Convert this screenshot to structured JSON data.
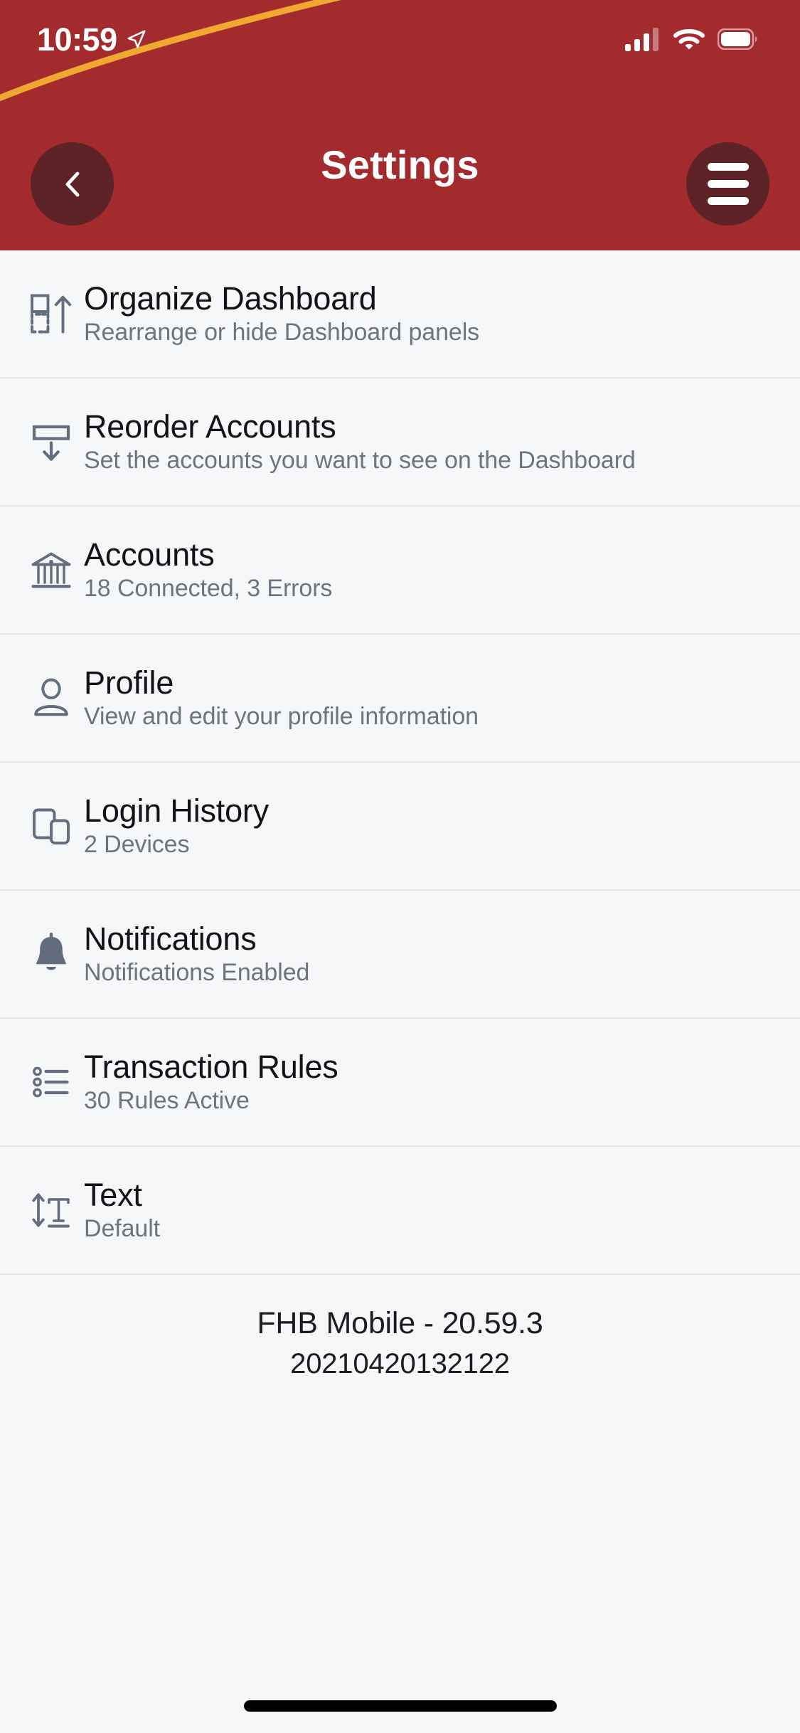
{
  "status_bar": {
    "time": "10:59",
    "location_icon": "location-arrow-icon",
    "signal_icon": "cellular-signal-icon",
    "signal_bars_filled": 3,
    "signal_bars_total": 4,
    "wifi_icon": "wifi-icon",
    "battery_icon": "battery-full-icon"
  },
  "header": {
    "title": "Settings",
    "back_icon": "chevron-left-icon",
    "menu_icon": "hamburger-menu-icon",
    "background_color": "#A32B2E",
    "accent_arc_color": "#EFA830",
    "button_color": "#5E2326"
  },
  "settings_items": [
    {
      "icon": "organize-dashboard-icon",
      "title": "Organize Dashboard",
      "subtitle": "Rearrange or hide Dashboard panels"
    },
    {
      "icon": "reorder-accounts-icon",
      "title": "Reorder Accounts",
      "subtitle": "Set the accounts you want to see on the Dashboard"
    },
    {
      "icon": "bank-icon",
      "title": "Accounts",
      "subtitle": "18 Connected, 3 Errors"
    },
    {
      "icon": "person-icon",
      "title": "Profile",
      "subtitle": "View and edit your profile information"
    },
    {
      "icon": "devices-icon",
      "title": "Login History",
      "subtitle": "2 Devices"
    },
    {
      "icon": "bell-icon",
      "title": "Notifications",
      "subtitle": "Notifications Enabled"
    },
    {
      "icon": "list-rules-icon",
      "title": "Transaction Rules",
      "subtitle": "30 Rules Active"
    },
    {
      "icon": "text-size-icon",
      "title": "Text",
      "subtitle": "Default"
    }
  ],
  "footer": {
    "version": "FHB Mobile - 20.59.3",
    "build": "20210420132122"
  }
}
